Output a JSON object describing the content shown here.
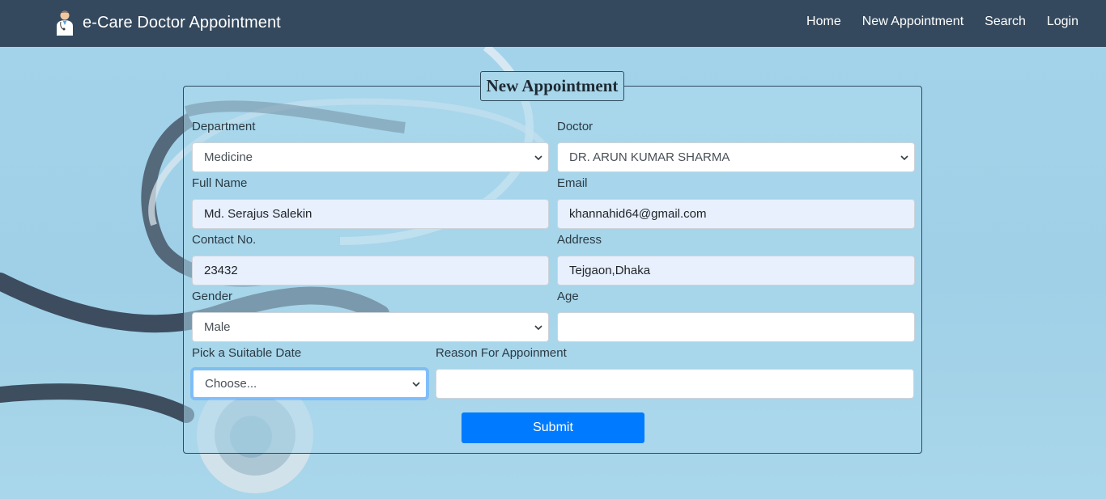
{
  "app": {
    "brand": "e-Care Doctor Appointment",
    "nav": [
      "Home",
      "New Appointment",
      "Search",
      "Login"
    ]
  },
  "form": {
    "legend": "New Appointment",
    "department": {
      "label": "Department",
      "value": "Medicine"
    },
    "doctor": {
      "label": "Doctor",
      "value": "DR. ARUN KUMAR SHARMA"
    },
    "full_name": {
      "label": "Full Name",
      "value": "Md. Serajus Salekin"
    },
    "email": {
      "label": "Email",
      "value": "khannahid64@gmail.com"
    },
    "contact": {
      "label": "Contact No.",
      "value": "23432"
    },
    "address": {
      "label": "Address",
      "value": "Tejgaon,Dhaka"
    },
    "gender": {
      "label": "Gender",
      "value": "Male"
    },
    "age": {
      "label": "Age",
      "value": ""
    },
    "date": {
      "label": "Pick a Suitable Date",
      "value": "Choose..."
    },
    "reason": {
      "label": "Reason For Appoinment",
      "value": ""
    },
    "submit_label": "Submit"
  },
  "colors": {
    "navbar": "#34495e",
    "accent": "#007bff",
    "background": "#a6d3e8",
    "autofill": "#e8f0fe"
  },
  "icons": {
    "brand_logo": "doctor-icon",
    "select_arrow": "chevron-down-icon"
  }
}
